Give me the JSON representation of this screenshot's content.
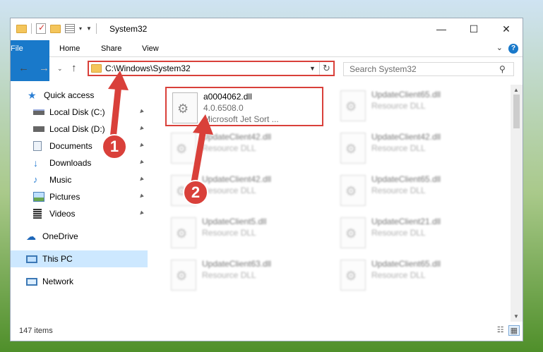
{
  "window": {
    "title": "System32"
  },
  "ribbon": {
    "tabs": [
      "File",
      "Home",
      "Share",
      "View"
    ],
    "help": "?"
  },
  "address": {
    "path": "C:\\Windows\\System32"
  },
  "search": {
    "placeholder": "Search System32"
  },
  "sidebar": {
    "items": [
      {
        "label": "Quick access",
        "icon": "star-icon"
      },
      {
        "label": "Local Disk (C:)",
        "icon": "drive-icon"
      },
      {
        "label": "Local Disk (D:)",
        "icon": "drive-icon"
      },
      {
        "label": "Documents",
        "icon": "document-icon"
      },
      {
        "label": "Downloads",
        "icon": "download-icon"
      },
      {
        "label": "Music",
        "icon": "music-icon"
      },
      {
        "label": "Pictures",
        "icon": "picture-icon"
      },
      {
        "label": "Videos",
        "icon": "video-icon"
      },
      {
        "label": "OneDrive",
        "icon": "cloud-icon"
      },
      {
        "label": "This PC",
        "icon": "computer-icon"
      },
      {
        "label": "Network",
        "icon": "network-icon"
      }
    ]
  },
  "files": [
    {
      "name": "a0004062.dll",
      "line2": "4.0.6508.0",
      "line3": "Microsoft Jet Sort ..."
    },
    {
      "name": "UpdateClient65.dll",
      "line2": "Resource DLL"
    },
    {
      "name": "UpdateClient42.dll",
      "line2": "Resource DLL"
    },
    {
      "name": "UpdateClient42.dll",
      "line2": "Resource DLL"
    },
    {
      "name": "UpdateClient42.dll",
      "line2": "Resource DLL"
    },
    {
      "name": "UpdateClient65.dll",
      "line2": "Resource DLL"
    },
    {
      "name": "UpdateClient5.dll",
      "line2": "Resource DLL"
    },
    {
      "name": "UpdateClient21.dll",
      "line2": "Resource DLL"
    },
    {
      "name": "UpdateClient63.dll",
      "line2": "Resource DLL"
    },
    {
      "name": "UpdateClient65.dll",
      "line2": "Resource DLL"
    }
  ],
  "status": {
    "count": "147 items"
  },
  "markers": [
    "1",
    "2"
  ],
  "colors": {
    "accent": "#1979ca",
    "annotation": "#d9403a",
    "selected": "#cde8ff"
  }
}
